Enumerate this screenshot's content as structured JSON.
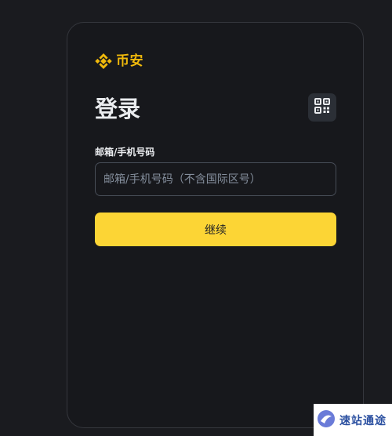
{
  "brand": {
    "name": "币安",
    "color": "#f0b90b",
    "icon": "binance-logo-icon"
  },
  "login": {
    "title": "登录",
    "qr_icon": "qr-code-icon",
    "field_label": "邮箱/手机号码",
    "input_placeholder": "邮箱/手机号码（不含国际区号）",
    "input_value": "",
    "continue_label": "继续",
    "accent_color": "#fcd535"
  },
  "watermark": {
    "text": "速站通途",
    "icon": "watermark-logo-icon"
  }
}
